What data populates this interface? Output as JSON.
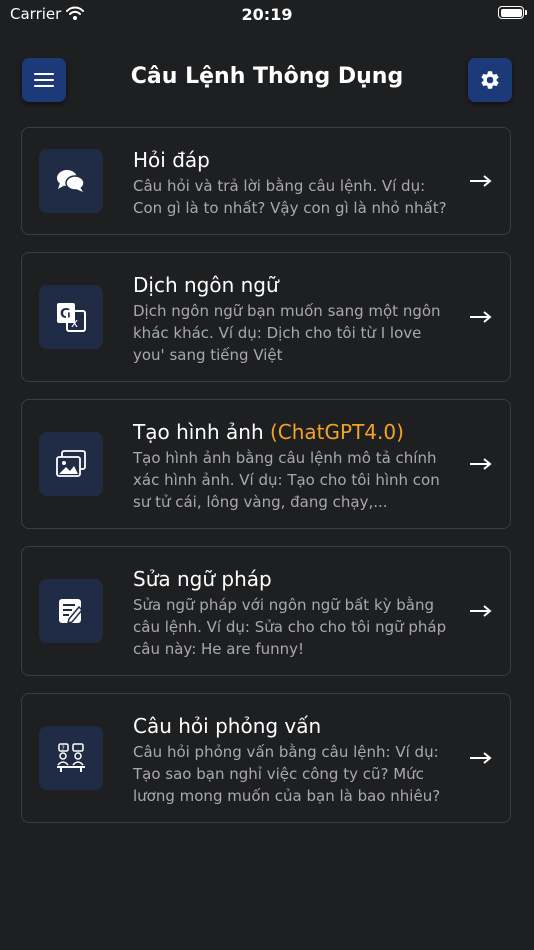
{
  "status_bar": {
    "carrier": "Carrier",
    "time": "20:19"
  },
  "header": {
    "title": "Câu Lệnh Thông Dụng",
    "menu_icon": "menu-icon",
    "settings_icon": "gear-icon"
  },
  "colors": {
    "background": "#1e1f21",
    "header_button": "#1c3a78",
    "icon_tile": "#202b45",
    "card_border": "#3c3d40",
    "highlight": "#f2a324",
    "desc_text": "#a9a9ad"
  },
  "cards": [
    {
      "title": "Hỏi đáp",
      "highlight": "",
      "description": "Câu hỏi và trả lời bằng câu lệnh. Ví dụ: Con gì là to nhất? Vậy con gì là nhỏ nhất?",
      "icon": "chat-bubbles-icon"
    },
    {
      "title": "Dịch ngôn ngữ",
      "highlight": "",
      "description": "Dịch ngôn ngữ bạn muốn sang một ngôn khác khác. Ví dụ: Dịch cho tôi từ I love you' sang tiếng Việt",
      "icon": "translate-icon"
    },
    {
      "title": "Tạo hình ảnh ",
      "highlight": "(ChatGPT4.0)",
      "description": "Tạo hình ảnh bằng câu lệnh mô tả chính xác hình ảnh. Ví dụ: Tạo cho tôi hình con sư tử cái, lông vàng, đang chạy,...",
      "icon": "image-gallery-icon"
    },
    {
      "title": "Sửa ngữ pháp",
      "highlight": "",
      "description": "Sửa ngữ pháp với ngôn ngữ bất kỳ bằng câu lệnh. Ví dụ: Sửa cho cho tôi ngữ pháp câu này: He are funny!",
      "icon": "edit-document-icon"
    },
    {
      "title": "Câu hỏi phỏng vấn",
      "highlight": "",
      "description": "Câu hỏi phỏng vấn bằng câu lệnh: Ví dụ: Tạo sao bạn nghỉ việc công ty cũ? Mức lương mong muốn của bạn là bao nhiêu?",
      "icon": "interview-icon"
    }
  ]
}
